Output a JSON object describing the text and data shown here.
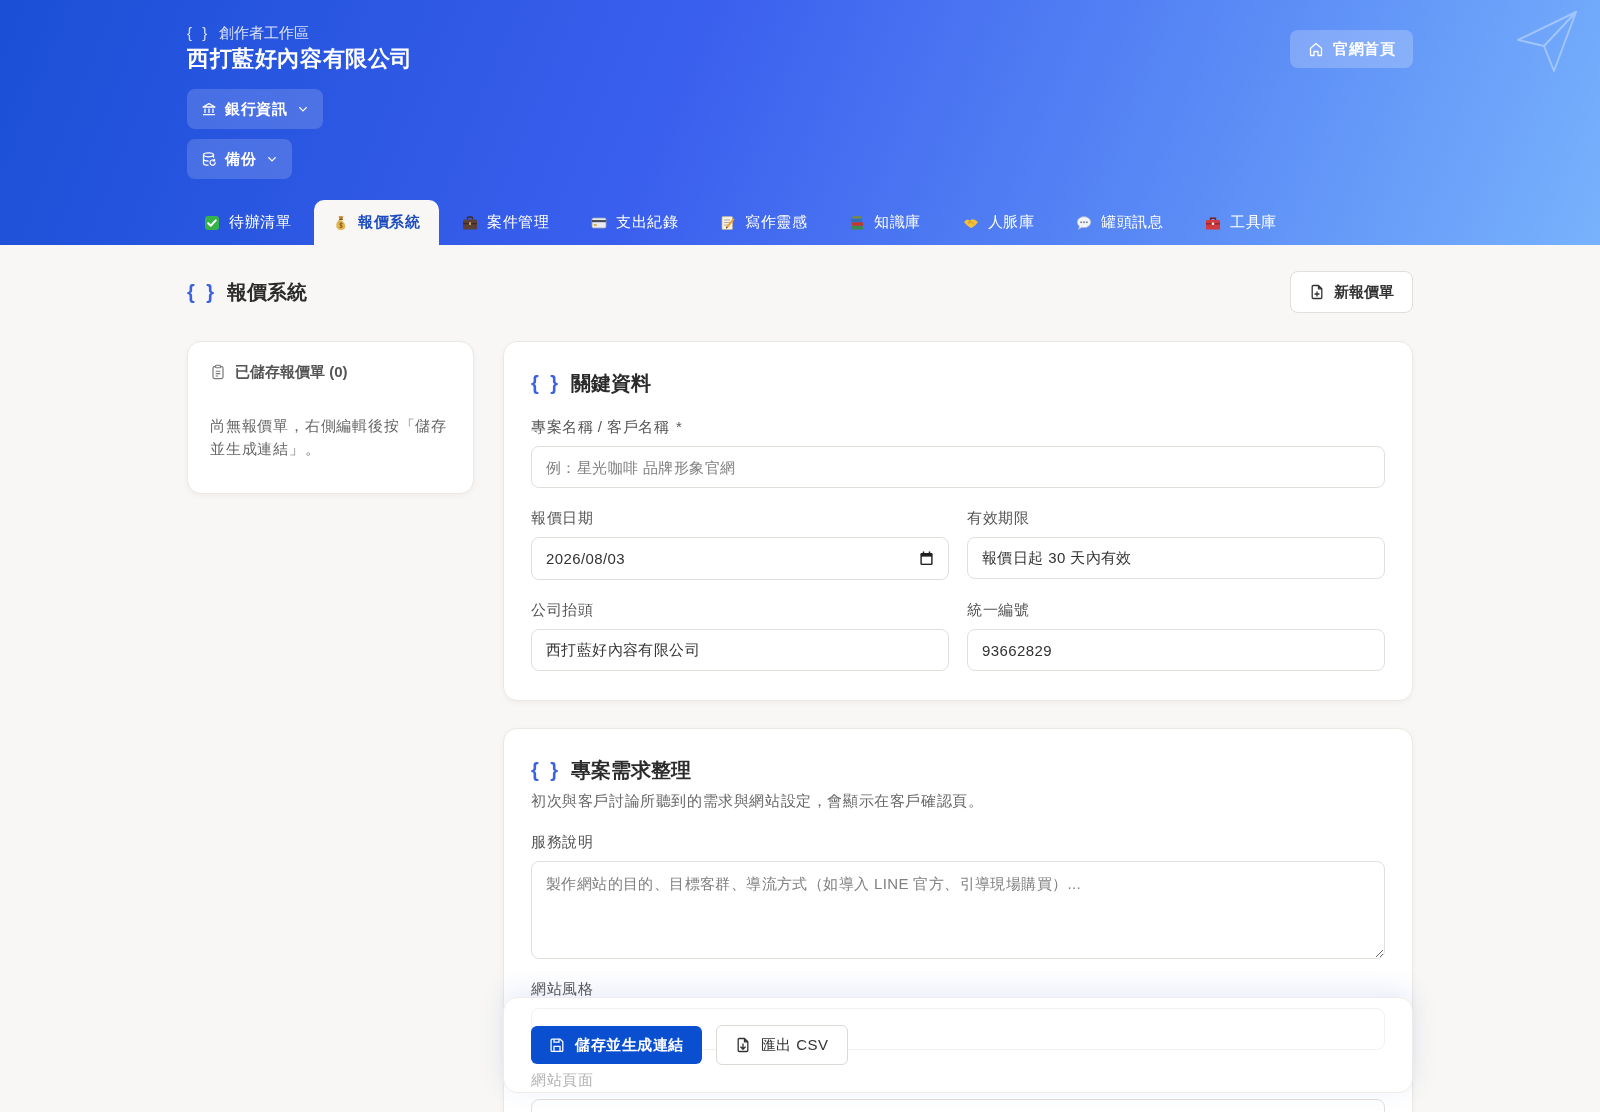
{
  "header": {
    "workspace": {
      "mark": "{ }",
      "label": "創作者工作區"
    },
    "company": "西打藍好內容有限公司",
    "menus": [
      {
        "kind": "bank",
        "label": "銀行資訊"
      },
      {
        "kind": "backup",
        "label": "備份"
      }
    ],
    "home_button": "官網首頁"
  },
  "tabs": [
    {
      "label": "待辦清單",
      "selected": false
    },
    {
      "label": "報價系統",
      "selected": true
    },
    {
      "label": "案件管理",
      "selected": false
    },
    {
      "label": "支出紀錄",
      "selected": false
    },
    {
      "label": "寫作靈感",
      "selected": false
    },
    {
      "label": "知識庫",
      "selected": false
    },
    {
      "label": "人脈庫",
      "selected": false
    },
    {
      "label": "罐頭訊息",
      "selected": false
    },
    {
      "label": "工具庫",
      "selected": false
    }
  ],
  "page_header": {
    "mark": "{ }",
    "title": "報價系統",
    "new_button": "新報價單"
  },
  "saved_quotes": {
    "title": "已儲存報價單 (0)",
    "empty_message": "尚無報價單，右側編輯後按「儲存並生成連結」。"
  },
  "sections": [
    {
      "mark": "{ }",
      "title": "關鍵資料",
      "rows": [
        [
          {
            "kind": "text",
            "label": "專案名稱 / 客戶名稱",
            "required_mark": "*",
            "placeholder": "例：星光咖啡 品牌形象官網"
          }
        ],
        [
          {
            "kind": "date",
            "label": "報價日期",
            "value": "2026/08/03"
          },
          {
            "kind": "text",
            "label": "有效期限",
            "value": "報價日起 30 天內有效"
          }
        ],
        [
          {
            "kind": "text",
            "label": "公司抬頭",
            "value": "西打藍好內容有限公司"
          },
          {
            "kind": "text",
            "label": "統一編號",
            "value": "93662829"
          }
        ]
      ]
    },
    {
      "mark": "{ }",
      "title": "專案需求整理",
      "description": "初次與客戶討論所聽到的需求與網站設定，會顯示在客戶確認頁。",
      "rows": [
        [
          {
            "kind": "textarea",
            "label": "服務說明",
            "placeholder": "製作網站的目的、目標客群、導流方式（如導入 LINE 官方、引導現場購買）..."
          }
        ],
        [
          {
            "kind": "text",
            "label": "網站風格"
          }
        ],
        [
          {
            "kind": "textarea",
            "label": "網站頁面"
          }
        ]
      ]
    }
  ],
  "action_bar": {
    "save_button": "儲存並生成連結",
    "export_button": "匯出 CSV"
  }
}
